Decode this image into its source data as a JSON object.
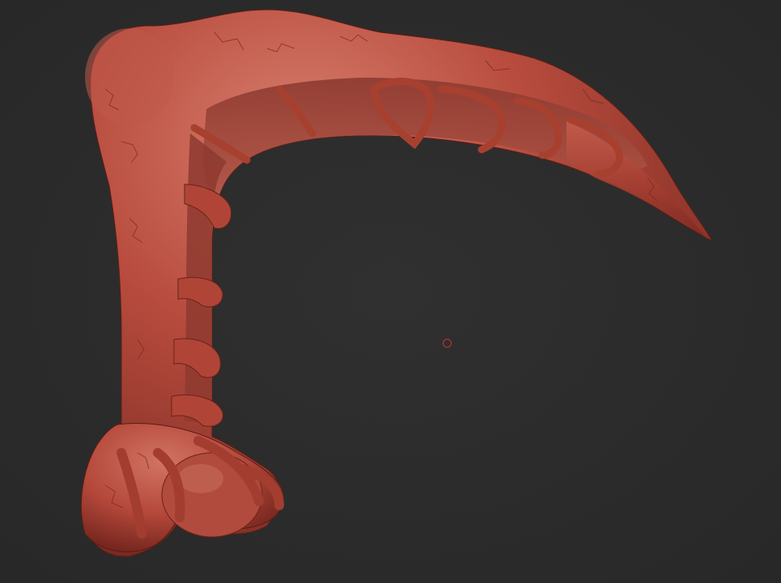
{
  "viewport": {
    "background_color": "#2b2b2b",
    "model": {
      "material_color": "#b4493c",
      "highlight_color": "#d97a6a",
      "shadow_color": "#6e241c"
    },
    "cursor": {
      "icon": "brush-cursor-icon",
      "color": "#c8332b"
    }
  }
}
